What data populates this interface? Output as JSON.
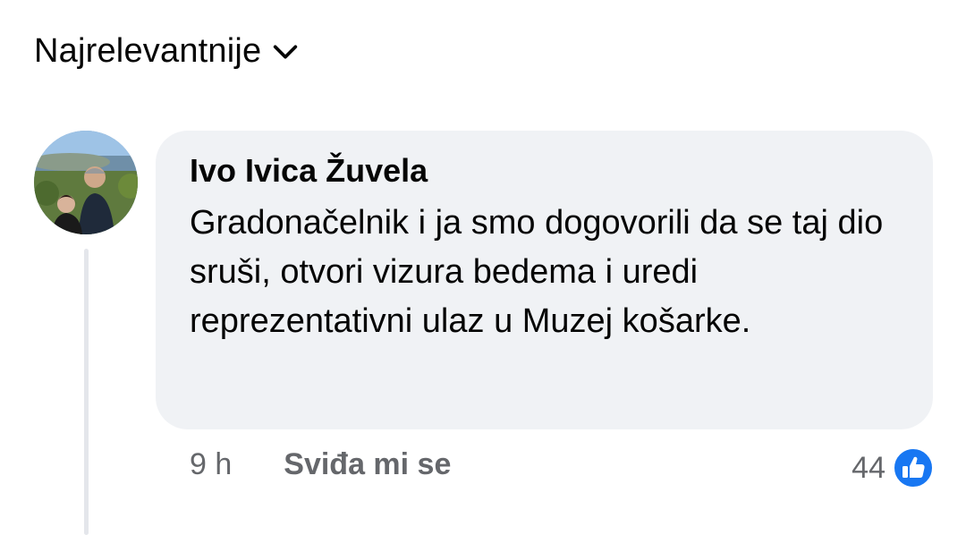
{
  "sort": {
    "label": "Najrelevantnije",
    "icon": "chevron-down-icon"
  },
  "comment": {
    "author": "Ivo Ivica Žuvela",
    "text": "Gradonačelnik i ja smo dogovorili da se taj dio sruši, otvori vizura bedema i uredi reprezentativni ulaz u Muzej košarke.",
    "time": "9 h",
    "like_label": "Sviđa mi se",
    "reaction_count": "44",
    "reaction_icon": "thumbs-up-icon"
  },
  "colors": {
    "bubble": "#f0f2f5",
    "secondary_text": "#65676b",
    "like_blue": "#1877f2"
  }
}
